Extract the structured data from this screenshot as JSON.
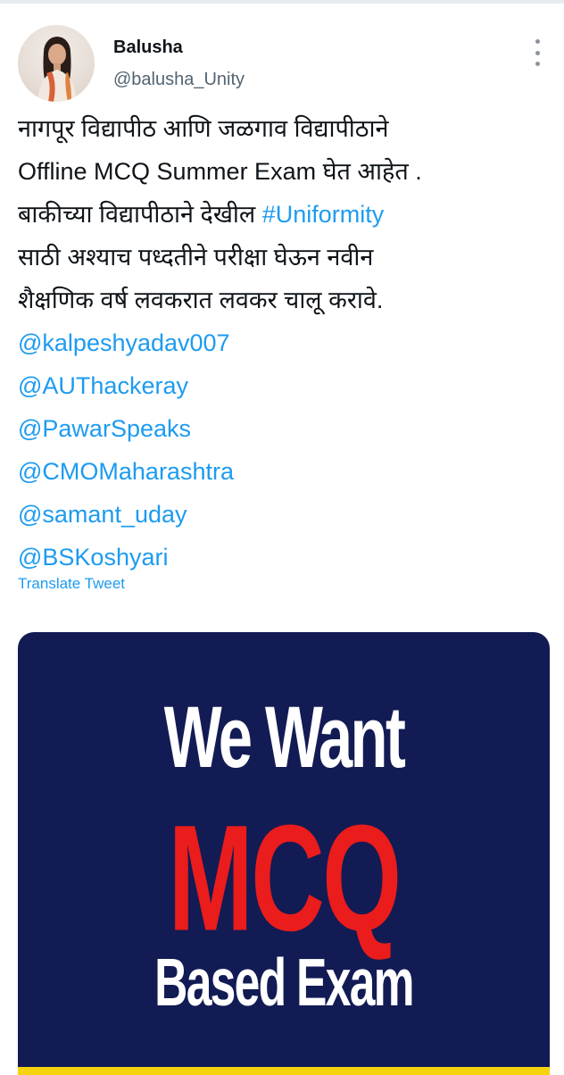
{
  "author": {
    "name": "Balusha",
    "handle": "@balusha_Unity",
    "avatar_icon": "profile-photo"
  },
  "more_icon": "vertical-dots-icon",
  "tweet": {
    "line1": "नागपूर विद्यापीठ आणि जळगाव विद्यापीठाने",
    "line2": "Offline MCQ Summer Exam घेत आहेत .",
    "line3_prefix": "बाकीच्या विद्यापीठाने देखील ",
    "hashtag": "#Uniformity",
    "line4": "साठी अश्याच पध्दतीने परीक्षा घेऊन नवीन",
    "line5": "शैक्षणिक वर्ष लवकरात लवकर चालू करावे.",
    "mentions": [
      "@kalpeshyadav007",
      "@AUThackeray",
      "@PawarSpeaks",
      "@CMOMaharashtra",
      "@samant_uday",
      "@BSKoshyari"
    ]
  },
  "translate_label": "Translate Tweet",
  "media": {
    "line1": "We Want",
    "line2": "MCQ",
    "line3": "Based Exam",
    "colors": {
      "background": "#121b54",
      "headline": "#ffffff",
      "accent": "#ea1c1c",
      "footer_strip": "#f6d30c"
    }
  },
  "colors": {
    "link": "#1d9bf0",
    "text": "#0f1419",
    "secondary": "#536471"
  }
}
